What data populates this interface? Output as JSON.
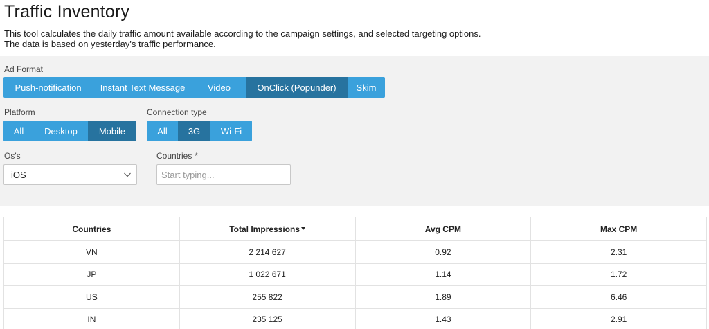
{
  "page": {
    "title": "Traffic Inventory",
    "description_line1": "This tool calculates the daily traffic amount available according to the campaign settings, and selected targeting options.",
    "description_line2": "The data is based on yesterday's traffic performance."
  },
  "ad_format": {
    "label": "Ad Format",
    "options": [
      "Push-notification",
      "Instant Text Message",
      "Video",
      "OnClick (Popunder)",
      "Skim"
    ],
    "selected": "OnClick (Popunder)"
  },
  "platform": {
    "label": "Platform",
    "options": [
      "All",
      "Desktop",
      "Mobile"
    ],
    "selected": "Mobile"
  },
  "connection_type": {
    "label": "Connection type",
    "options": [
      "All",
      "3G",
      "Wi-Fi"
    ],
    "selected": "3G"
  },
  "os": {
    "label": "Os's",
    "value": "iOS",
    "icon": "chevron-down-icon"
  },
  "countries": {
    "label": "Countries",
    "required_mark": "*",
    "placeholder": "Start typing..."
  },
  "table": {
    "columns": [
      "Countries",
      "Total Impressions",
      "Avg CPM",
      "Max CPM"
    ],
    "sorted_column": "Total Impressions",
    "rows": [
      {
        "country": "VN",
        "impressions": "2 214 627",
        "avg_cpm": "0.92",
        "max_cpm": "2.31"
      },
      {
        "country": "JP",
        "impressions": "1 022 671",
        "avg_cpm": "1.14",
        "max_cpm": "1.72"
      },
      {
        "country": "US",
        "impressions": "255 822",
        "avg_cpm": "1.89",
        "max_cpm": "6.46"
      },
      {
        "country": "IN",
        "impressions": "235 125",
        "avg_cpm": "1.43",
        "max_cpm": "2.91"
      }
    ]
  },
  "colors": {
    "button": "#3aa1dc",
    "button_active": "#27739f",
    "filter_panel_bg": "#f2f2f2"
  }
}
